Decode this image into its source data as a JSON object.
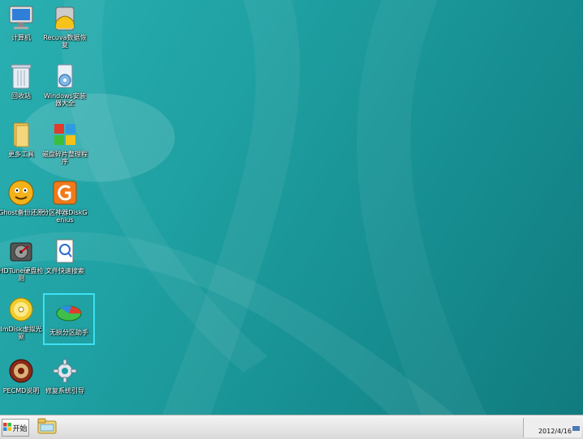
{
  "desktop": {
    "icons": [
      {
        "label": "计算机",
        "icon": "computer-icon"
      },
      {
        "label": "Recuva数据恢复",
        "icon": "recuva-icon"
      },
      {
        "label": "回收站",
        "icon": "recycle-bin-icon"
      },
      {
        "label": "Windows安装器大全",
        "icon": "windows-installer-icon"
      },
      {
        "label": "更多工具",
        "icon": "folder-icon"
      },
      {
        "label": "磁盘碎片整理程序",
        "icon": "defrag-icon"
      },
      {
        "label": "Ghost备份还原",
        "icon": "ghost-icon"
      },
      {
        "label": "分区神器DiskGenius",
        "icon": "diskgenius-icon"
      },
      {
        "label": "HDTune硬盘检测",
        "icon": "hdtune-icon"
      },
      {
        "label": "文件快速搜索",
        "icon": "file-search-icon"
      },
      {
        "label": "ImDisk虚拟光驱",
        "icon": "imdisk-icon"
      },
      {
        "label": "无损分区助手",
        "icon": "partition-assistant-icon"
      },
      {
        "label": "PECMD说明",
        "icon": "pecmd-icon"
      },
      {
        "label": "修复系统引导",
        "icon": "gear-icon"
      }
    ],
    "selected_icon": "无损分区助手"
  },
  "taskbar": {
    "start_label": "开始",
    "pinned": [
      {
        "icon": "explorer-folder-icon"
      }
    ],
    "clock_date": "2012/4/16"
  }
}
